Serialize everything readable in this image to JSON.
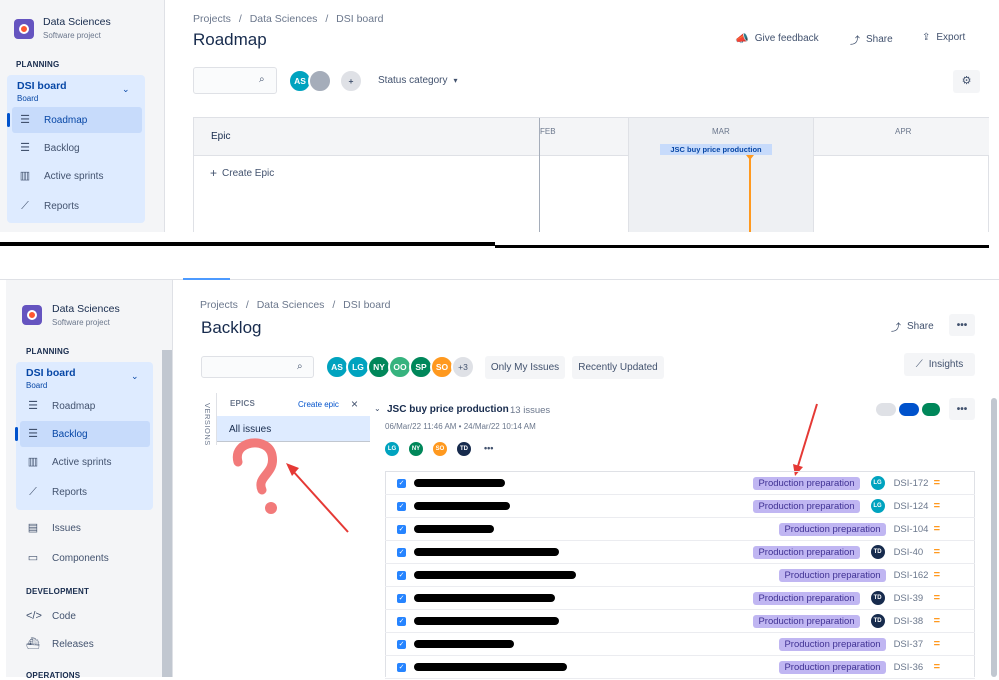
{
  "top": {
    "project": {
      "name": "Data Sciences",
      "type": "Software project"
    },
    "planning_label": "PLANNING",
    "board": {
      "title": "DSI board",
      "sub": "Board"
    },
    "nav": [
      "Roadmap",
      "Backlog",
      "Active sprints",
      "Reports"
    ],
    "breadcrumbs": [
      "Projects",
      "/",
      "Data Sciences",
      "/",
      "DSI board"
    ],
    "title": "Roadmap",
    "actions": {
      "feedback": "Give feedback",
      "share": "Share",
      "export": "Export"
    },
    "avatars": [
      {
        "initials": "AS",
        "color": "#00a3bf"
      }
    ],
    "status_category": "Status category",
    "table": {
      "epic_header": "Epic",
      "months": [
        "FEB",
        "MAR",
        "APR"
      ],
      "create_epic": "Create Epic",
      "bar_label": "JSC buy price production"
    }
  },
  "bottom": {
    "project": {
      "name": "Data Sciences",
      "type": "Software project"
    },
    "planning_label": "PLANNING",
    "board": {
      "title": "DSI board",
      "sub": "Board"
    },
    "nav": [
      "Roadmap",
      "Backlog",
      "Active sprints",
      "Reports"
    ],
    "extra_nav": [
      "Issues",
      "Components"
    ],
    "development_label": "DEVELOPMENT",
    "dev_nav": [
      "Code",
      "Releases"
    ],
    "operations_label": "OPERATIONS",
    "breadcrumbs": [
      "Projects",
      "/",
      "Data Sciences",
      "/",
      "DSI board"
    ],
    "title": "Backlog",
    "share": "Share",
    "avatars": [
      {
        "initials": "AS",
        "color": "#00a3bf"
      },
      {
        "initials": "LG",
        "color": "#00a3bf"
      },
      {
        "initials": "NY",
        "color": "#00875a"
      },
      {
        "initials": "OO",
        "color": "#36b37e"
      },
      {
        "initials": "SP",
        "color": "#00875a"
      },
      {
        "initials": "SO",
        "color": "#ff991f"
      }
    ],
    "more_count": "+3",
    "filters": [
      "Only My Issues",
      "Recently Updated"
    ],
    "insights": "Insights",
    "versions_tab": "VERSIONS",
    "epics_panel": {
      "title": "EPICS",
      "create": "Create epic",
      "close": "×",
      "all_issues": "All issues"
    },
    "sprint": {
      "name": "JSC buy price production",
      "count": "13 issues",
      "dates": "06/Mar/22 11:46 AM • 24/Mar/22 10:14 AM",
      "assignees": [
        {
          "initials": "LG",
          "color": "#00a3bf"
        },
        {
          "initials": "NY",
          "color": "#00875a"
        },
        {
          "initials": "SO",
          "color": "#ff991f"
        },
        {
          "initials": "TD",
          "color": "#172b4d"
        }
      ],
      "more": "•••"
    },
    "issues": [
      {
        "label": "Production preparation",
        "assignee": "LG",
        "assignee_color": "#00a3bf",
        "key": "DSI-172"
      },
      {
        "label": "Production preparation",
        "assignee": "LG",
        "assignee_color": "#00a3bf",
        "key": "DSI-124"
      },
      {
        "label": "Production preparation",
        "assignee": "",
        "assignee_color": "",
        "key": "DSI-104"
      },
      {
        "label": "Production preparation",
        "assignee": "TD",
        "assignee_color": "#172b4d",
        "key": "DSI-40"
      },
      {
        "label": "Production preparation",
        "assignee": "",
        "assignee_color": "",
        "key": "DSI-162"
      },
      {
        "label": "Production preparation",
        "assignee": "TD",
        "assignee_color": "#172b4d",
        "key": "DSI-39"
      },
      {
        "label": "Production preparation",
        "assignee": "TD",
        "assignee_color": "#172b4d",
        "key": "DSI-38"
      },
      {
        "label": "Production preparation",
        "assignee": "",
        "assignee_color": "",
        "key": "DSI-37"
      },
      {
        "label": "Production preparation",
        "assignee": "",
        "assignee_color": "",
        "key": "DSI-36"
      }
    ]
  },
  "colors": {
    "accent": "#0052cc",
    "label_bg": "#c0b6f2",
    "annotation": "#e53935"
  }
}
